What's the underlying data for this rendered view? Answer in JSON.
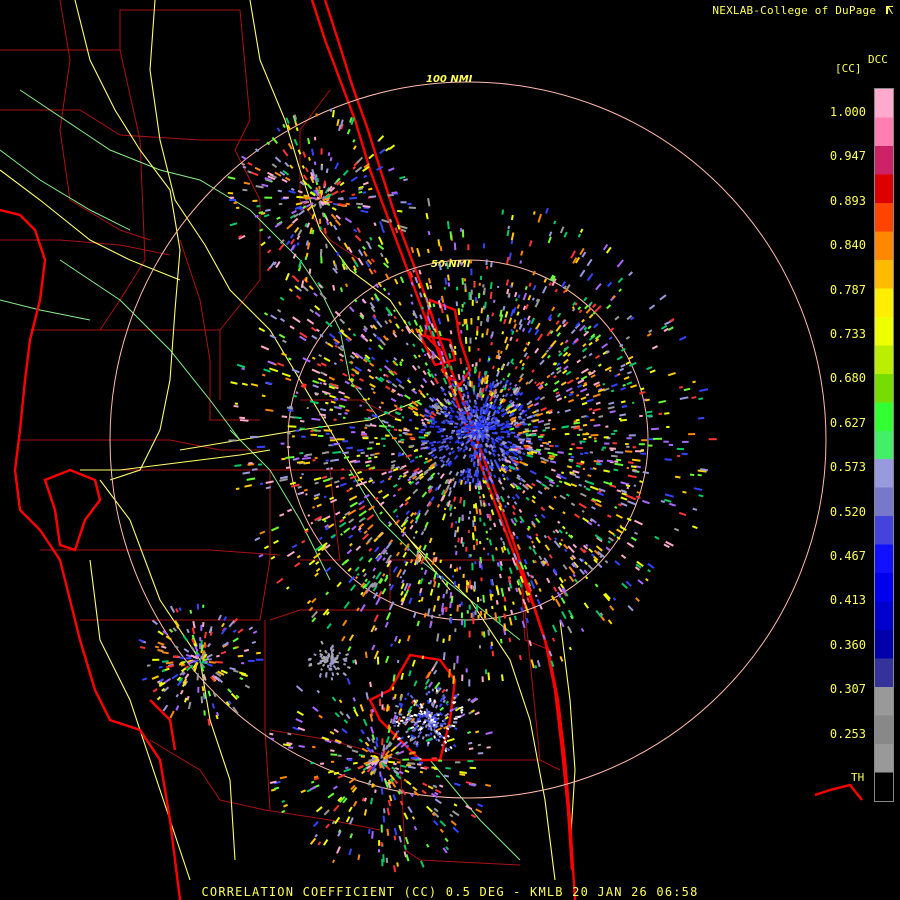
{
  "header": {
    "credit": "NEXLAB-College of DuPage"
  },
  "rings": [
    {
      "label": "100 NMI"
    },
    {
      "label": "50 NMI"
    }
  ],
  "scale": {
    "product_code": "DCC",
    "units": "[CC]",
    "ticks": [
      "1.000",
      "0.947",
      "0.893",
      "0.840",
      "0.787",
      "0.733",
      "0.680",
      "0.627",
      "0.573",
      "0.520",
      "0.467",
      "0.413",
      "0.360",
      "0.307",
      "0.253"
    ],
    "threshold_label": "TH",
    "colors": [
      "#ffaacc",
      "#ff7fb0",
      "#cc2266",
      "#dd0000",
      "#ff4400",
      "#ff8800",
      "#ffbb00",
      "#ffee00",
      "#eeff00",
      "#bbee00",
      "#77dd00",
      "#33ff33",
      "#44ee66",
      "#9999dd",
      "#7777cc",
      "#4444dd",
      "#1111ff",
      "#0000ee",
      "#0000cc",
      "#0000aa",
      "#333399",
      "#999999",
      "#888888",
      "#999999",
      "#000000"
    ]
  },
  "footer": {
    "caption": "CORRELATION COEFFICIENT (CC) 0.5 DEG - KMLB 20 JAN 26 06:58"
  },
  "colors": {
    "text": "#ffff55",
    "coast": "#ff0000",
    "county": "#aa1111",
    "roads": "#ffff66",
    "rivers": "#88ee88",
    "rings": "#ffbbaa"
  }
}
